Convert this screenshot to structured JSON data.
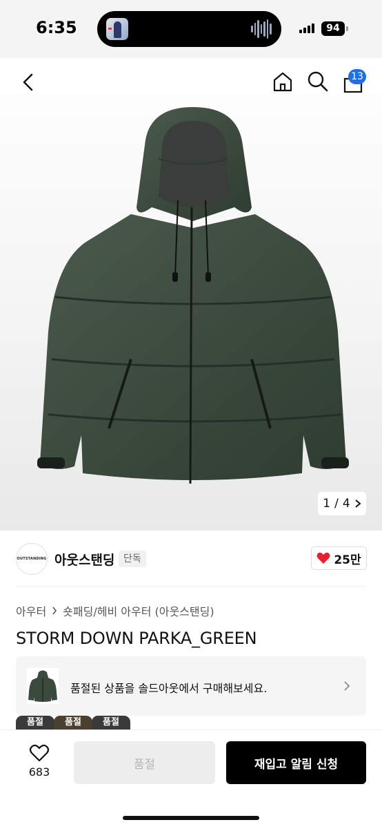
{
  "status_bar": {
    "time": "6:35",
    "battery": "94"
  },
  "header": {
    "cart_count": "13"
  },
  "gallery": {
    "current": "1",
    "separator": "/",
    "total": "4"
  },
  "brand": {
    "logo_text": "OUTSTANDING",
    "name": "아웃스탠딩",
    "tag": "단독",
    "likes": "25만"
  },
  "breadcrumb": {
    "category": "아우터",
    "subcategory": "숏패딩/헤비 아우터 (아웃스탠딩)"
  },
  "product": {
    "title": "STORM DOWN PARKA_GREEN",
    "jacket_color": "#3a4a3d"
  },
  "soldout_banner": {
    "text": "품절된 상품을 솔드아웃에서 구매해보세요."
  },
  "chips": [
    "품절",
    "품절",
    "품절"
  ],
  "bottom_bar": {
    "wish_count": "683",
    "soldout_label": "품절",
    "restock_label": "재입고 알림 신청"
  },
  "colors": {
    "badge": "#1e6fe6",
    "heart": "#e8202f"
  }
}
